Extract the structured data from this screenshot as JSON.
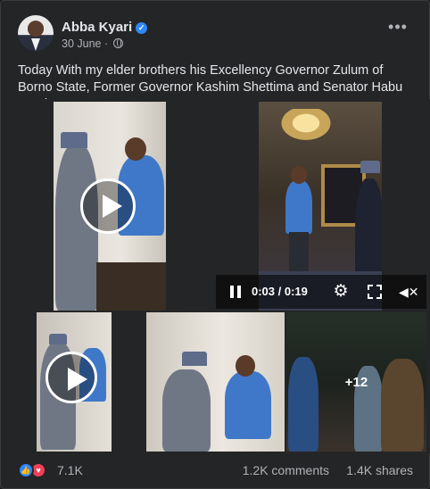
{
  "post": {
    "author": "Abba Kyari",
    "date": "30 June",
    "separator": "·",
    "text": "Today With my elder brothers his Excellency Governor Zulum of Borno State, Former Governor Kashim Shettima and Senator Habu Kyari."
  },
  "video": {
    "time": "0:03 / 0:19"
  },
  "media": {
    "more_count": "+12"
  },
  "footer": {
    "reaction_count": "7.1K",
    "comments": "1.2K comments",
    "shares": "1.4K shares"
  },
  "icons": {
    "verified": "verified-badge-icon",
    "privacy": "globe-icon",
    "more": "more-options-icon",
    "like": "like-icon",
    "love": "love-icon"
  },
  "colors": {
    "card_bg": "#242526",
    "accent": "#2d88ff",
    "love": "#f33e58",
    "secondary_text": "#b0b3b8"
  }
}
